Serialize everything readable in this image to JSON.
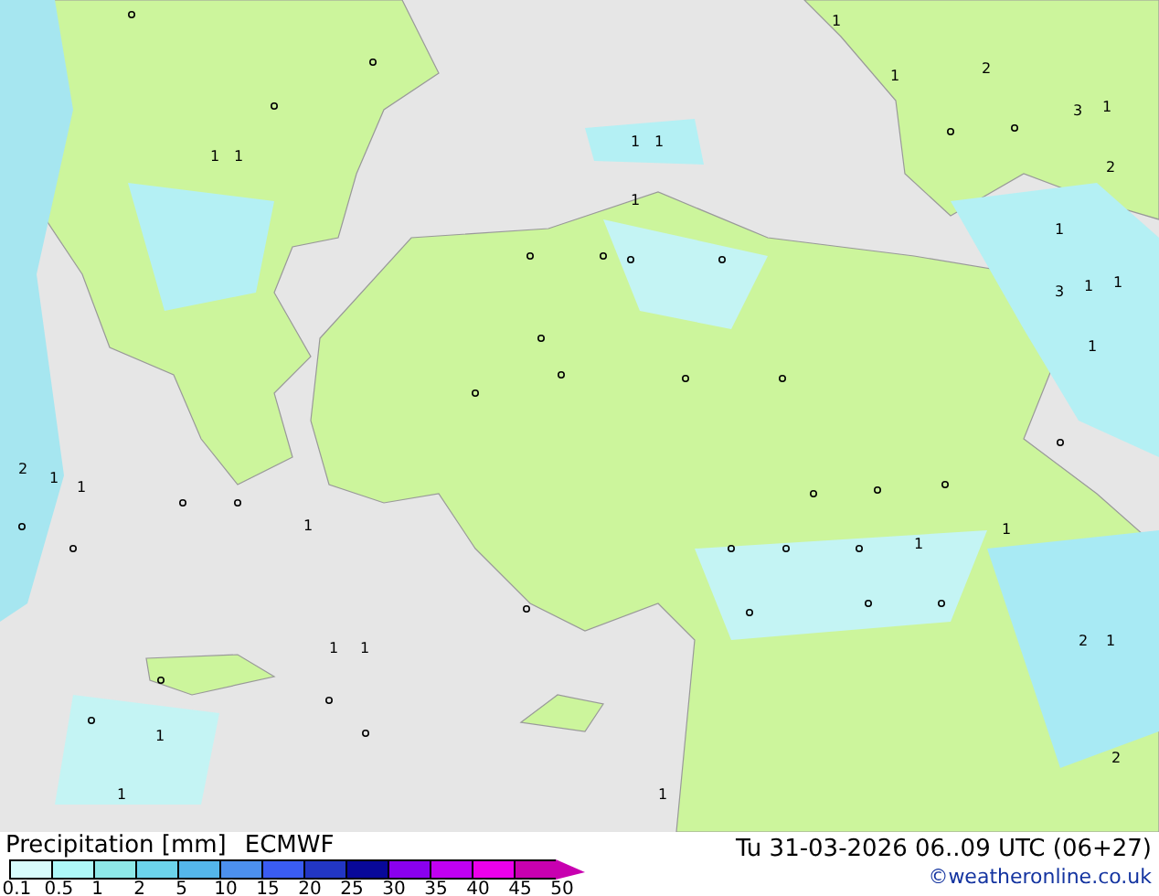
{
  "map_labels": [
    "1",
    "2",
    "1",
    "3",
    "1",
    "2",
    "1",
    "1",
    "1",
    "1",
    "1",
    "1",
    "3",
    "1",
    "1",
    "1",
    "2",
    "1",
    "1",
    "1",
    "1",
    "2",
    "1",
    "1",
    "1",
    "1",
    "2",
    "1",
    "1",
    "1"
  ],
  "legend": {
    "title": "Precipitation [mm]",
    "model": "ECMWF",
    "bins": [
      {
        "color": "#d8fcfc"
      },
      {
        "color": "#aef8f8"
      },
      {
        "color": "#8ee8e8"
      },
      {
        "color": "#6cd4ec"
      },
      {
        "color": "#54b6ea"
      },
      {
        "color": "#4c90ee"
      },
      {
        "color": "#3a5cf2"
      },
      {
        "color": "#2236c4"
      },
      {
        "color": "#08089a"
      },
      {
        "color": "#8a00ee"
      },
      {
        "color": "#c000f2"
      },
      {
        "color": "#ec00ec"
      },
      {
        "color": "#c800b0"
      }
    ],
    "ticks": [
      "0.1",
      "0.5",
      "1",
      "2",
      "5",
      "10",
      "15",
      "20",
      "25",
      "30",
      "35",
      "40",
      "45",
      "50"
    ]
  },
  "valid_time": "Tu 31-03-2026 06..09 UTC (06+27)",
  "credit": "©weatheronline.co.uk"
}
